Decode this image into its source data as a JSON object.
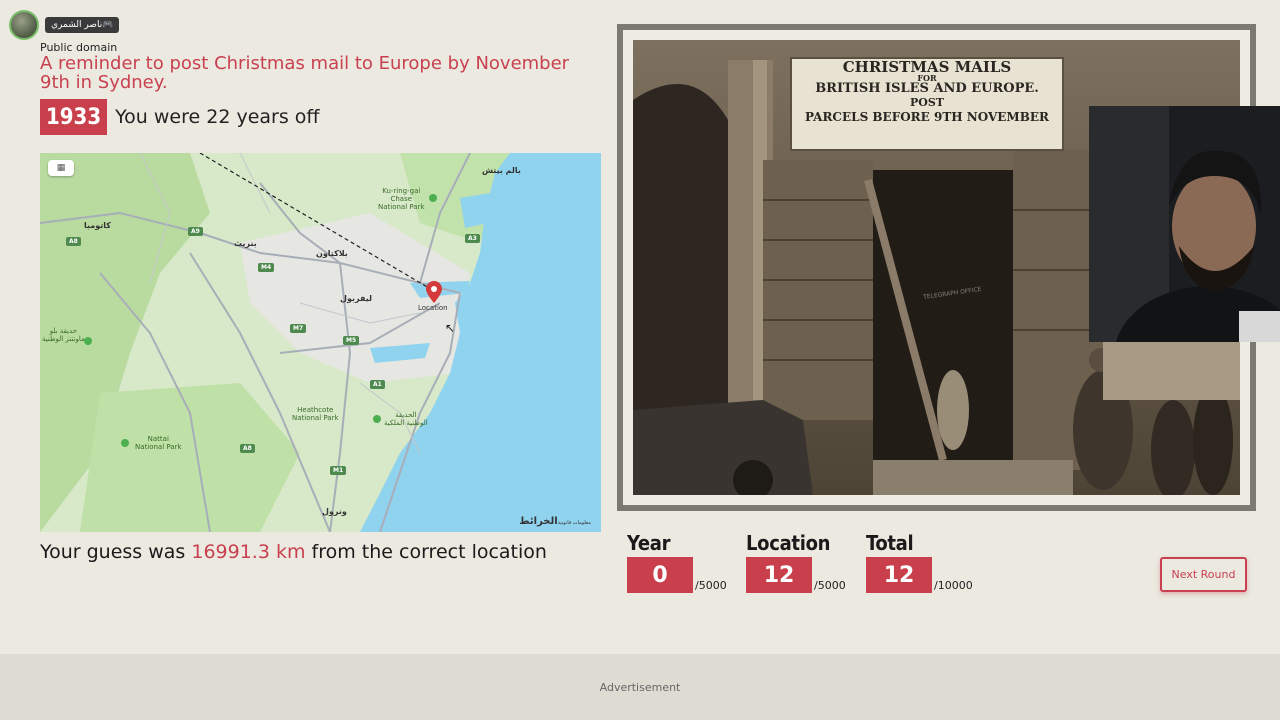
{
  "user": {
    "name": "ناصر الشمري🎮"
  },
  "round": {
    "license": "Public domain",
    "description": "A reminder to post Christmas mail to Europe by November 9th in Sydney.",
    "year": "1933",
    "year_feedback": "You were 22 years off",
    "distance_prefix": "Your guess was ",
    "distance_value": "16991.3 km",
    "distance_suffix": " from the correct location"
  },
  "map": {
    "toggle_icon": "map-icon",
    "pin_label": "Location",
    "labels": {
      "north": "بالم بيتش",
      "kuringgai": "Ku-ring-gai\nChase\nNational Park",
      "katoomba": "كاتومبا",
      "penrith": "بنريث",
      "blacktown": "بلاكتاون",
      "liverpool": "ليفربول",
      "blue_mountains": "حديقة بلو\nماونتنز الوطنية",
      "heathcote": "Heathcote\nNational Park",
      "royal": "الحديقة\nالوطنية الملكية",
      "nattai": "Nattai\nNational Park",
      "wollongong": "ونرول"
    },
    "shields": [
      "A9",
      "M4",
      "A3",
      "M7",
      "M5",
      "A1",
      "M1",
      "A8",
      "A8"
    ],
    "attribution": "الخرائط",
    "attribution_small": "معلومات قانونية"
  },
  "photo": {
    "sign_line1": "CHRISTMAS MAILS",
    "sign_line2": "FOR",
    "sign_line3": "BRITISH ISLES AND EUROPE.",
    "sign_line4": "POST",
    "sign_line5": "PARCELS BEFORE 9TH NOVEMBER",
    "office_sign": "TELEGRAPH OFFICE"
  },
  "scores": {
    "year": {
      "label": "Year",
      "value": "0",
      "max": "/5000"
    },
    "location": {
      "label": "Location",
      "value": "12",
      "max": "/5000"
    },
    "total": {
      "label": "Total",
      "value": "12",
      "max": "/10000"
    }
  },
  "next_button": "Next Round",
  "advertisement": "Advertisement",
  "colors": {
    "accent": "#c94050",
    "background": "#ebe9e0",
    "water": "#8fd3ef",
    "land": "#d7e9c8"
  }
}
